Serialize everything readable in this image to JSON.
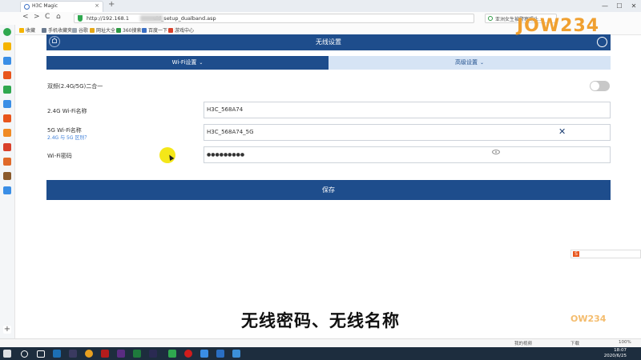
{
  "browser": {
    "tab_title": "H3C Magic",
    "tab_close": "×",
    "new_tab": "+",
    "url_prefix": "http://192.168.1",
    "url_suffix": "uid_setup_dualband.asp",
    "search_text": "亚洲女生被警察踢头...",
    "nav": {
      "back": "<",
      "forward": ">",
      "refresh": "C",
      "home": "⌂"
    },
    "window_controls": [
      "—",
      "☐",
      "✕"
    ]
  },
  "bookmarks": [
    {
      "label": "收藏",
      "color": "#f5b400"
    },
    {
      "label": "手机收藏夹",
      "color": "#6b7a8f"
    },
    {
      "label": "谷歌",
      "color": "#9aa5b1"
    },
    {
      "label": "网址大全",
      "color": "#e6a817"
    },
    {
      "label": "360搜索",
      "color": "#2e9a44"
    },
    {
      "label": "百度一下",
      "color": "#3a6fc4"
    },
    {
      "label": "游戏中心",
      "color": "#d9412b"
    }
  ],
  "router": {
    "title": "无线设置",
    "tabs": {
      "wifi": "Wi-Fi设置",
      "advanced": "高级设置",
      "chevron": "⌄"
    },
    "dual_band_label": "双频(2.4G/5G)二合一",
    "wifi24_label": "2.4G Wi-Fi名称",
    "wifi24_value": "H3C_568A74",
    "wifi5_label": "5G Wi-Fi名称",
    "wifi5_sub": "2.4G 与 5G 区别？",
    "wifi5_value": "H3C_568A74_5G",
    "clear_icon": "✕",
    "password_label": "Wi-Fi密码",
    "password_value": "●●●●●●●●●",
    "save_label": "保存"
  },
  "overlay": {
    "logo": "JOW234",
    "logo_small": "OW234",
    "subtitle": "无线密码、无线名称",
    "ime_letter": "S"
  },
  "statusbar": {
    "left": "",
    "right_items": [
      "我的视频",
      "下载"
    ],
    "zoom": "100%"
  },
  "clock": {
    "time": "18:07",
    "date": "2020/6/25"
  }
}
